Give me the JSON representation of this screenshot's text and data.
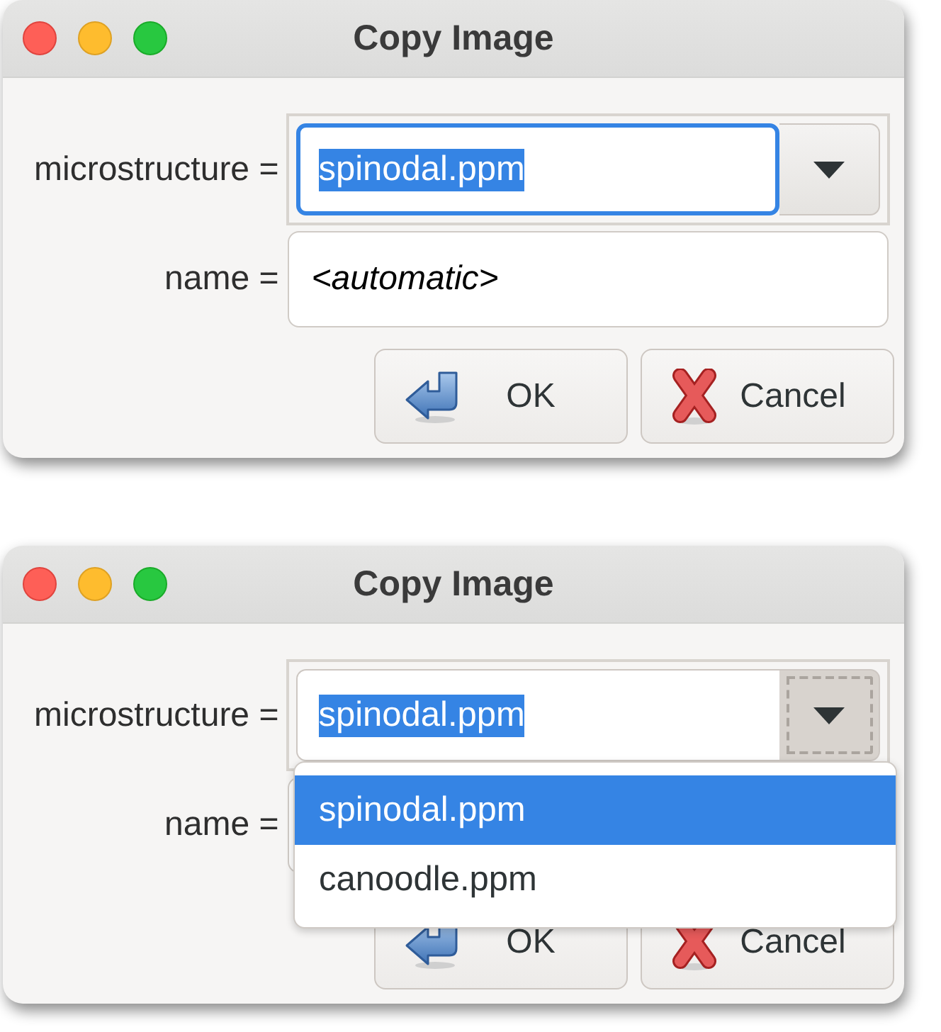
{
  "windows": [
    {
      "title": "Copy Image",
      "fields": [
        {
          "kind": "combo",
          "label": "microstructure =",
          "value": "spinodal.ppm",
          "text_selected": true,
          "focused": true,
          "expanded": false
        },
        {
          "kind": "text",
          "label": "name =",
          "value": "<automatic>"
        }
      ],
      "buttons": [
        {
          "kind": "ok",
          "label": "OK"
        },
        {
          "kind": "cancel",
          "label": "Cancel"
        }
      ]
    },
    {
      "title": "Copy Image",
      "fields": [
        {
          "kind": "combo",
          "label": "microstructure =",
          "value": "spinodal.ppm",
          "text_selected": true,
          "focused": false,
          "expanded": true,
          "options": [
            {
              "label": "spinodal.ppm",
              "selected": true
            },
            {
              "label": "canoodle.ppm",
              "selected": false
            }
          ]
        },
        {
          "kind": "text",
          "label": "name ="
        }
      ],
      "buttons": [
        {
          "kind": "ok",
          "label": "OK"
        },
        {
          "kind": "cancel",
          "label": "Cancel"
        }
      ]
    }
  ]
}
